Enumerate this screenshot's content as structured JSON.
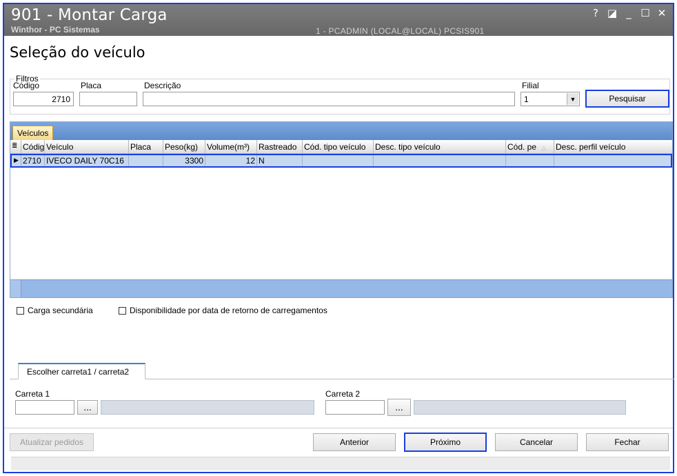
{
  "window": {
    "title": "901 - Montar Carga",
    "subtitle": "Winthor - PC Sistemas",
    "session": "1 - PCADMIN (LOCAL@LOCAL)   PCSIS901",
    "controls": [
      "?",
      "◪",
      "_",
      "☐",
      "✕"
    ]
  },
  "page": {
    "title": "Seleção do veículo"
  },
  "filters": {
    "legend": "Filtros",
    "codigo_label": "Código",
    "codigo_value": "2710",
    "placa_label": "Placa",
    "placa_value": "",
    "descricao_label": "Descrição",
    "descricao_value": "",
    "filial_label": "Filial",
    "filial_value": "1",
    "search_button": "Pesquisar"
  },
  "grid": {
    "tab": "Veículos",
    "columns": [
      "Códig",
      "Veículo",
      "Placa",
      "Peso(kg)",
      "Volume(m³)",
      "Rastreado",
      "Cód. tipo veículo",
      "Desc. tipo veículo",
      "Cód. pe",
      "Desc. perfil veículo"
    ],
    "rows": [
      [
        "2710",
        "IVECO DAILY 70C16",
        "",
        "3300",
        "12",
        "N",
        "",
        "",
        "",
        ""
      ]
    ]
  },
  "options": {
    "carga_secundaria": "Carga secundária",
    "disponibilidade": "Disponibilidade por data de retorno de carregamentos"
  },
  "carretas": {
    "tab": "Escolher carreta1 / carreta2",
    "carreta1_label": "Carreta 1",
    "carreta2_label": "Carreta 2",
    "browse": "..."
  },
  "footer": {
    "atualizar": "Atualizar pedidos",
    "anterior": "Anterior",
    "proximo": "Próximo",
    "cancelar": "Cancelar",
    "fechar": "Fechar"
  }
}
